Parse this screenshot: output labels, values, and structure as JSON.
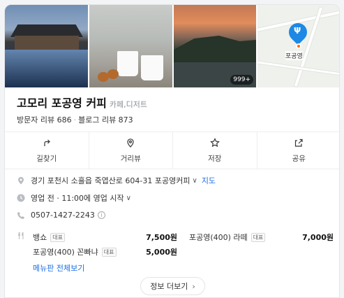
{
  "photos": {
    "count_badge": "999+",
    "map_label": "포공영",
    "map_pin_glyph": "Ψ"
  },
  "place": {
    "name": "고모리 포공영 커피",
    "category": "카페,디저트",
    "visitor_reviews": "방문자 리뷰 686",
    "separator": "·",
    "blog_reviews": "블로그 리뷰 873"
  },
  "actions": [
    {
      "label": "길찾기",
      "icon": "directions-icon"
    },
    {
      "label": "거리뷰",
      "icon": "street-view-icon"
    },
    {
      "label": "저장",
      "icon": "star-icon"
    },
    {
      "label": "공유",
      "icon": "share-icon"
    }
  ],
  "info": {
    "address": "경기 포천시 소흘읍 죽엽산로 604-31 포공영커피",
    "map_link": "지도",
    "hours": "영업 전 · 11:00에 영업 시작",
    "phone": "0507-1427-2243",
    "phone_info_icon": "i"
  },
  "menu": {
    "rep_badge": "대표",
    "items": [
      {
        "name": "뱅쇼",
        "price": "7,500원"
      },
      {
        "name": "포공영(400) 라떼",
        "price": "7,000원"
      },
      {
        "name": "포공영(400) 꼰빠냐",
        "price": "5,000원"
      }
    ],
    "all_link": "메뉴판 전체보기"
  },
  "more_button": "정보 더보기",
  "colors": {
    "link": "#1d6fe5",
    "pin": "#1e88e5",
    "pin_dot": "#ff6a00"
  }
}
